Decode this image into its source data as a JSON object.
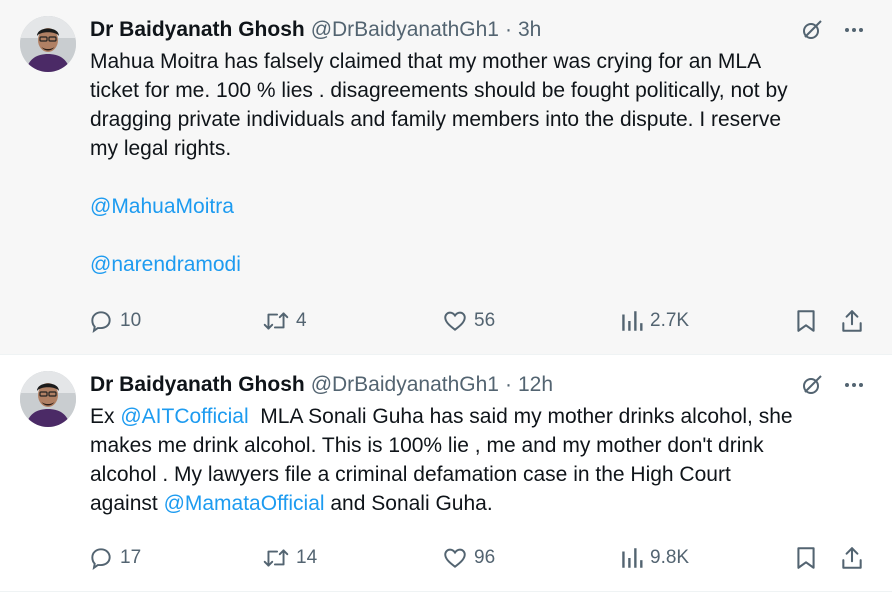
{
  "tweets": [
    {
      "author_name": "Dr Baidyanath Ghosh",
      "handle": "@DrBaidyanathGh1",
      "separator": "·",
      "time": "3h",
      "text_lines": [
        "Mahua Moitra has falsely claimed that my mother was crying for an MLA",
        "ticket for me. 100 % lies .  disagreements should be fought politically, not by",
        "dragging private individuals and family members into the dispute. I reserve",
        "my legal rights."
      ],
      "mentions": [
        "@MahuaMoitra",
        "@narendramodi"
      ],
      "replies": "10",
      "reposts": "4",
      "likes": "56",
      "views": "2.7K",
      "colors": {
        "background": "#f7f7f7",
        "link": "#1d9bf0",
        "muted": "#536471"
      },
      "icons": [
        "grok-icon",
        "more-icon",
        "reply-icon",
        "repost-icon",
        "like-icon",
        "views-icon",
        "bookmark-icon",
        "share-icon"
      ]
    },
    {
      "author_name": "Dr Baidyanath Ghosh",
      "handle": "@DrBaidyanathGh1",
      "separator": "·",
      "time": "12h",
      "line1_prefix": "Ex ",
      "line1_mention": "@AITCofficial",
      "line1_suffix": "  MLA Sonali Guha has said my mother drinks alcohol, she",
      "line2": "makes me drink alcohol. This is 100% lie , me and my mother don't drink",
      "line3": "alcohol . My lawyers file a criminal defamation case in the High Court",
      "line4_prefix": "against ",
      "line4_mention": "@MamataOfficial",
      "line4_suffix": " and Sonali Guha.",
      "replies": "17",
      "reposts": "14",
      "likes": "96",
      "views": "9.8K",
      "colors": {
        "background": "#ffffff",
        "link": "#1d9bf0",
        "muted": "#536471"
      }
    }
  ]
}
